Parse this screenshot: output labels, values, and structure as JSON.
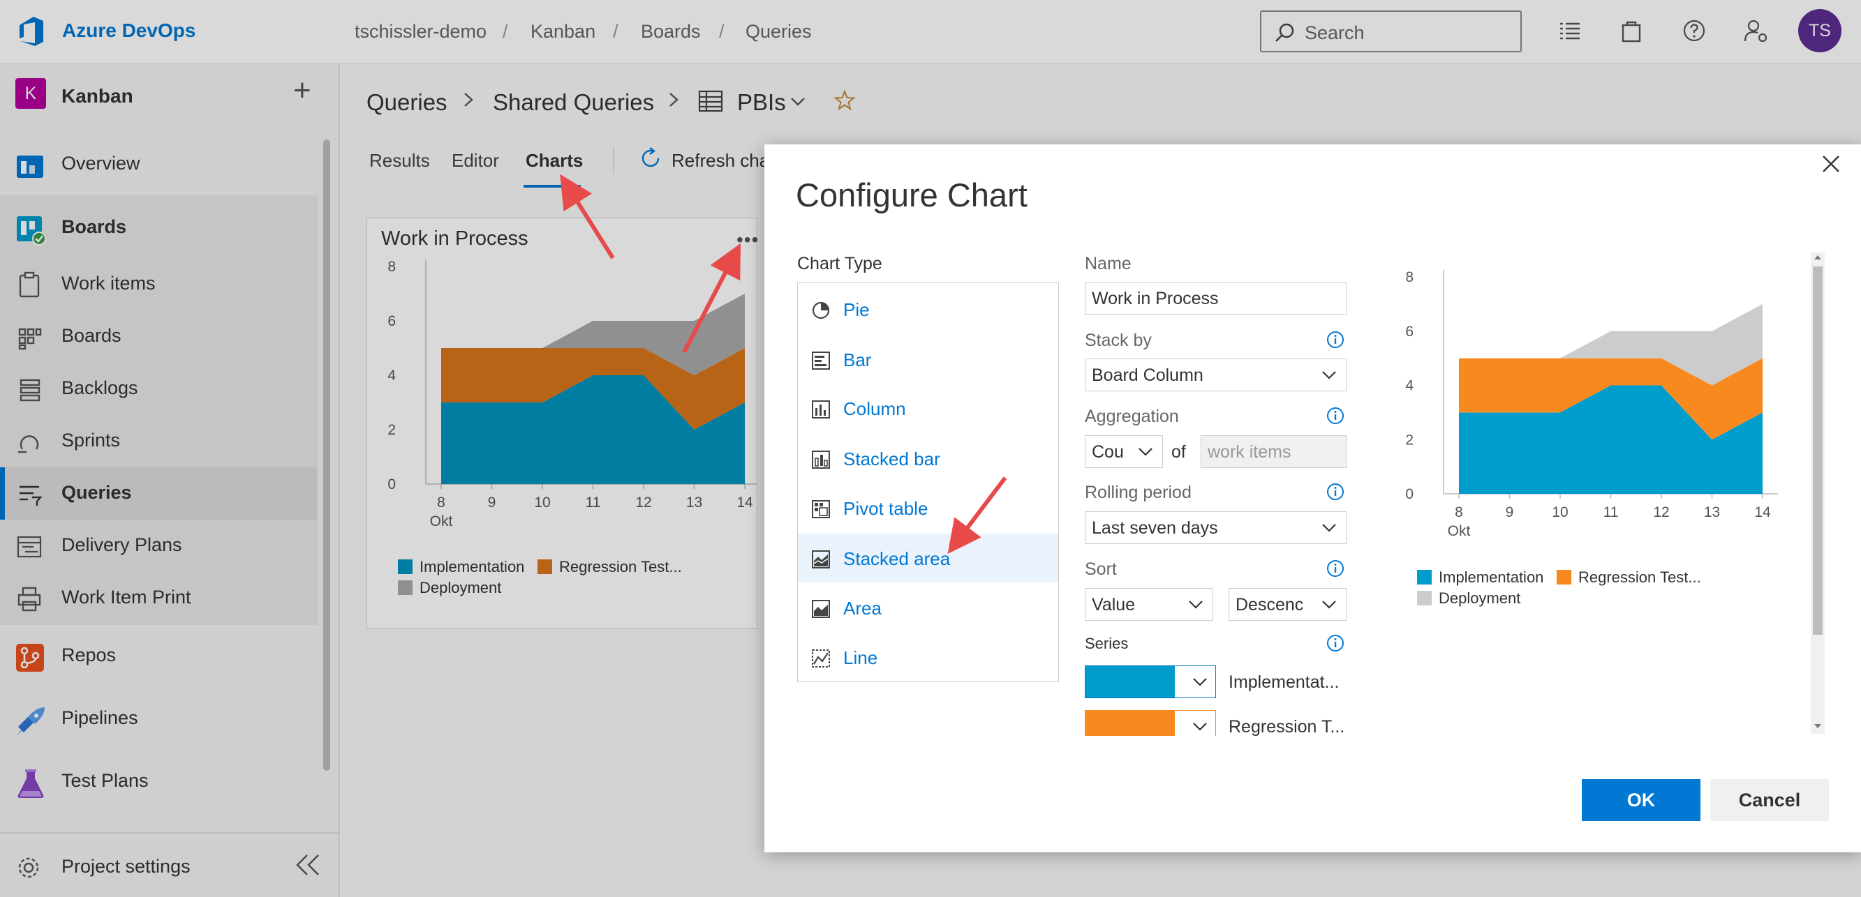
{
  "topbar": {
    "brand": "Azure DevOps",
    "breadcrumbs": [
      "tschissler-demo",
      "Kanban",
      "Boards",
      "Queries"
    ],
    "separator": "/",
    "search_placeholder": "Search",
    "avatar_initials": "TS",
    "icons": [
      "list-icon",
      "shopping-bag-icon",
      "help-icon",
      "user-settings-icon"
    ]
  },
  "sidebar": {
    "project_initial": "K",
    "project_name": "Kanban",
    "add_label": "+",
    "items": [
      {
        "label": "Overview",
        "icon": "overview-icon",
        "color": "#0078d4"
      },
      {
        "label": "Boards",
        "icon": "boards-app-icon",
        "color": "#009ccc"
      },
      {
        "label": "Work items",
        "icon": "work-items-icon"
      },
      {
        "label": "Boards",
        "icon": "boards-icon"
      },
      {
        "label": "Backlogs",
        "icon": "backlogs-icon"
      },
      {
        "label": "Sprints",
        "icon": "sprints-icon"
      },
      {
        "label": "Queries",
        "icon": "queries-icon"
      },
      {
        "label": "Delivery Plans",
        "icon": "delivery-plans-icon"
      },
      {
        "label": "Work Item Print",
        "icon": "print-icon"
      },
      {
        "label": "Repos",
        "icon": "repos-icon",
        "color": "#e8501f"
      },
      {
        "label": "Pipelines",
        "icon": "pipelines-icon",
        "color": "#2e75d6"
      },
      {
        "label": "Test Plans",
        "icon": "test-plans-icon",
        "color": "#8a46c4"
      }
    ],
    "settings_label": "Project settings",
    "collapse_icon": "double-chevron-left-icon"
  },
  "main": {
    "breadcrumb": [
      "Queries",
      "Shared Queries",
      "PBIs"
    ],
    "tabs": [
      "Results",
      "Editor",
      "Charts"
    ],
    "active_tab": "Charts",
    "refresh_label": "Refresh cha",
    "card_title": "Work in Process",
    "card_more": "•••"
  },
  "dialog": {
    "title": "Configure Chart",
    "chart_type_label": "Chart Type",
    "chart_types": [
      {
        "label": "Pie",
        "icon": "pie-icon"
      },
      {
        "label": "Bar",
        "icon": "bar-icon"
      },
      {
        "label": "Column",
        "icon": "column-icon"
      },
      {
        "label": "Stacked bar",
        "icon": "stacked-bar-icon"
      },
      {
        "label": "Pivot table",
        "icon": "pivot-table-icon"
      },
      {
        "label": "Stacked area",
        "icon": "stacked-area-icon"
      },
      {
        "label": "Area",
        "icon": "area-icon"
      },
      {
        "label": "Line",
        "icon": "line-icon"
      }
    ],
    "selected_type": "Stacked area",
    "name_label": "Name",
    "name_value": "Work in Process",
    "stack_by_label": "Stack by",
    "stack_by_value": "Board Column",
    "aggregation_label": "Aggregation",
    "aggregation_value": "Cou",
    "of_label": "of",
    "aggregation_field": "work items",
    "rolling_label": "Rolling period",
    "rolling_value": "Last seven days",
    "sort_label": "Sort",
    "sort_value": "Value",
    "sort_order": "Descenc",
    "series_label": "Series",
    "series": [
      {
        "name": "Implementat...",
        "color": "#009ccc"
      },
      {
        "name": "Regression T...",
        "color": "#f7891f"
      }
    ],
    "ok_label": "OK",
    "cancel_label": "Cancel"
  },
  "chart_data": [
    {
      "type": "area",
      "stacked": true,
      "x": [
        "8",
        "9",
        "10",
        "11",
        "12",
        "13",
        "14"
      ],
      "x_sublabel": "Okt",
      "ylim": [
        0,
        8
      ],
      "yticks": [
        0,
        2,
        4,
        6,
        8
      ],
      "grid": false,
      "legend": "bottom-left",
      "series": [
        {
          "name": "Implementation",
          "values": [
            3,
            3,
            3,
            4,
            4,
            2,
            3
          ],
          "color": "#0093bd"
        },
        {
          "name": "Regression Test...",
          "values": [
            2,
            2,
            2,
            1,
            1,
            2,
            2
          ],
          "color": "#d9761c"
        },
        {
          "name": "Deployment",
          "values": [
            0,
            0,
            0,
            1,
            1,
            2,
            2
          ],
          "color": "#aaaaaa"
        }
      ]
    },
    {
      "type": "area",
      "stacked": true,
      "x": [
        "8",
        "9",
        "10",
        "11",
        "12",
        "13",
        "14"
      ],
      "x_sublabel": "Okt",
      "ylim": [
        0,
        8
      ],
      "yticks": [
        0,
        2,
        4,
        6,
        8
      ],
      "grid": false,
      "legend": "bottom-left",
      "series": [
        {
          "name": "Implementation",
          "values": [
            3,
            3,
            3,
            4,
            4,
            2,
            3
          ],
          "color": "#009ccc"
        },
        {
          "name": "Regression Test...",
          "values": [
            2,
            2,
            2,
            1,
            1,
            2,
            2
          ],
          "color": "#f7891f"
        },
        {
          "name": "Deployment",
          "values": [
            0,
            0,
            0,
            1,
            1,
            2,
            2
          ],
          "color": "#cccccc"
        }
      ]
    }
  ]
}
